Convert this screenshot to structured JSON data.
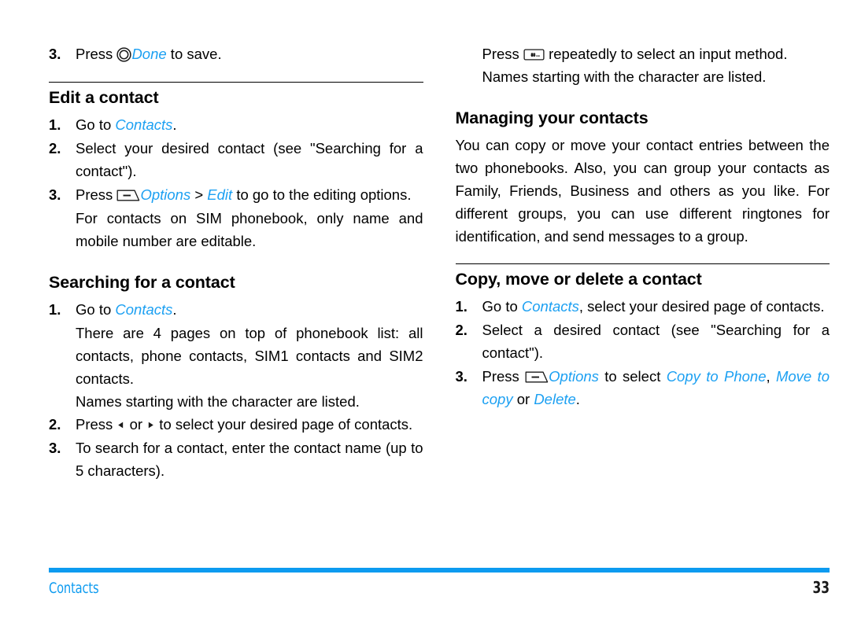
{
  "document": {
    "footer_label": "Contacts",
    "page_number": "33",
    "accent_color": "#0D9BF0",
    "link_color": "#1CA0F2"
  },
  "left_column": {
    "step_prev": {
      "number": "3.",
      "text_before": "Press ",
      "icon": "circle-select-key-icon",
      "link": "Done",
      "text_after": " to save."
    },
    "section_edit": {
      "heading": "Edit a contact",
      "steps": [
        {
          "number": "1.",
          "text_before": "Go to ",
          "link": "Contacts",
          "text_after": "."
        },
        {
          "number": "2.",
          "text_before": "Select your desired contact (see \"Searching for a contact\")."
        },
        {
          "number": "3.",
          "text_before": "Press ",
          "icon": "left-softkey-icon",
          "link": "Options",
          "text_mid": " > ",
          "link2": "Edit",
          "text_after": " to go to the editing options.",
          "note": "For contacts on SIM phonebook, only name and mobile number are editable."
        }
      ]
    },
    "section_search": {
      "heading": "Searching for a contact",
      "steps": [
        {
          "number": "1.",
          "text_before": "Go to ",
          "link": "Contacts",
          "text_after": ".",
          "note1": "There are 4 pages on top of phonebook list: all contacts, phone contacts, SIM1 contacts and SIM2 contacts.",
          "note2": "Names starting with the character are listed."
        },
        {
          "number": "2.",
          "text_before": "Press ",
          "icon_left": "left-arrow-key-icon",
          "text_mid": " or ",
          "icon_right": "right-arrow-key-icon",
          "text_after": " to select your desired page of contacts."
        },
        {
          "number": "3.",
          "text_before": "To search for a contact, enter the contact name (up to 5 characters)."
        }
      ]
    }
  },
  "right_column": {
    "continued": {
      "text_before": "Press ",
      "icon": "hash-input-key-icon",
      "text_after": " repeatedly to select an input method.",
      "note": "Names starting with the character are listed."
    },
    "section_managing": {
      "heading": "Managing your contacts",
      "paragraph": "You can copy or move your contact entries between the two phonebooks. Also, you can group your contacts as Family, Friends, Business and others as you like. For different groups, you can use different ringtones for identification, and send messages to a group."
    },
    "section_copy": {
      "heading": "Copy, move or delete a contact",
      "steps": [
        {
          "number": "1.",
          "text_before": "Go to ",
          "link": "Contacts",
          "text_after": ", select your desired page of contacts."
        },
        {
          "number": "2.",
          "text_before": "Select a desired contact (see \"Searching for a contact\")."
        },
        {
          "number": "3.",
          "text_before": "Press ",
          "icon": "left-softkey-icon",
          "link": "Options",
          "text_mid": " to select ",
          "link2": "Copy to Phone",
          "text_mid2": ", ",
          "link3": "Move to copy",
          "text_mid3": " or ",
          "link4": "Delete",
          "text_after": "."
        }
      ]
    }
  }
}
